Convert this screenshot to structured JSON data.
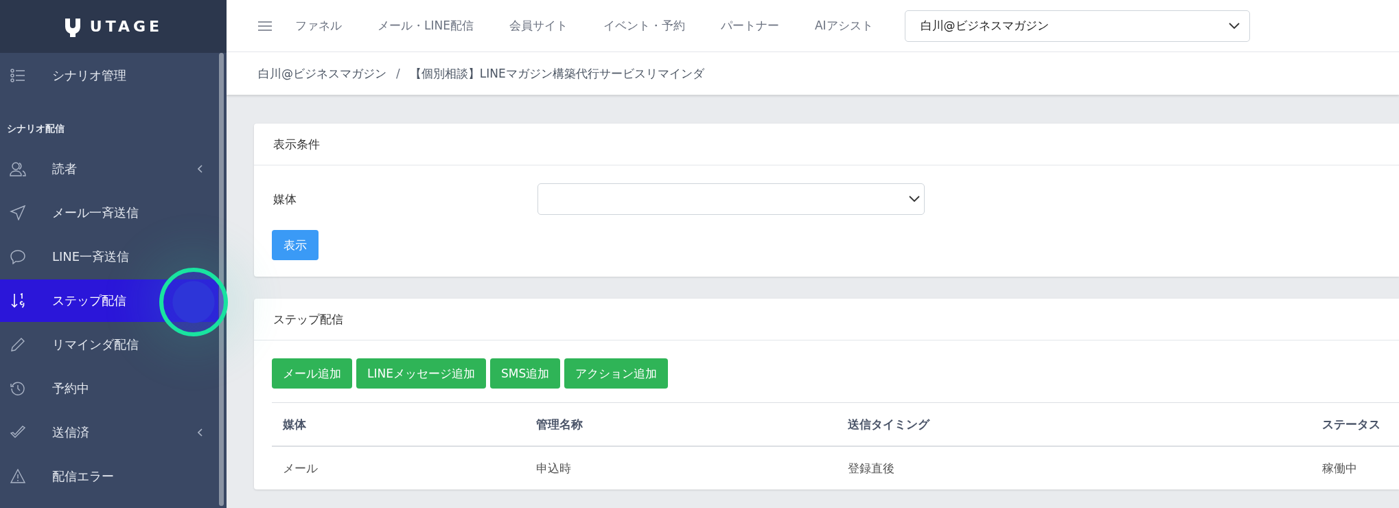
{
  "logo": {
    "text": "UTAGE"
  },
  "sidebar": {
    "top_item": {
      "label": "シナリオ管理",
      "selected": false
    },
    "section_heading": "シナリオ配信",
    "items": [
      {
        "label": "読者",
        "selected": false,
        "has_submenu": true
      },
      {
        "label": "メール一斉送信",
        "selected": false,
        "has_submenu": false
      },
      {
        "label": "LINE一斉送信",
        "selected": false,
        "has_submenu": false
      },
      {
        "label": "ステップ配信",
        "selected": true,
        "has_submenu": false
      },
      {
        "label": "リマインダ配信",
        "selected": false,
        "has_submenu": false
      },
      {
        "label": "予約中",
        "selected": false,
        "has_submenu": false
      },
      {
        "label": "送信済",
        "selected": false,
        "has_submenu": true
      },
      {
        "label": "配信エラー",
        "selected": false,
        "has_submenu": false
      }
    ]
  },
  "top_nav": {
    "items": [
      "ファネル",
      "メール・LINE配信",
      "会員サイト",
      "イベント・予約",
      "パートナー",
      "AIアシスト"
    ],
    "account_select": {
      "value": "白川@ビジネスマガジン"
    }
  },
  "breadcrumb": {
    "separator": "/",
    "items": [
      "白川@ビジネスマガジン",
      "【個別相談】LINEマガジン構築代行サービスリマインダ"
    ]
  },
  "filter_card": {
    "title": "表示条件",
    "field_label": "媒体",
    "button": "表示"
  },
  "step_card": {
    "title": "ステップ配信",
    "buttons": [
      "メール追加",
      "LINEメッセージ追加",
      "SMS追加",
      "アクション追加"
    ],
    "table": {
      "columns": [
        "媒体",
        "管理名称",
        "送信タイミング",
        "ステータス"
      ],
      "rows": [
        [
          "メール",
          "申込時",
          "登録直後",
          "稼働中"
        ]
      ]
    }
  }
}
